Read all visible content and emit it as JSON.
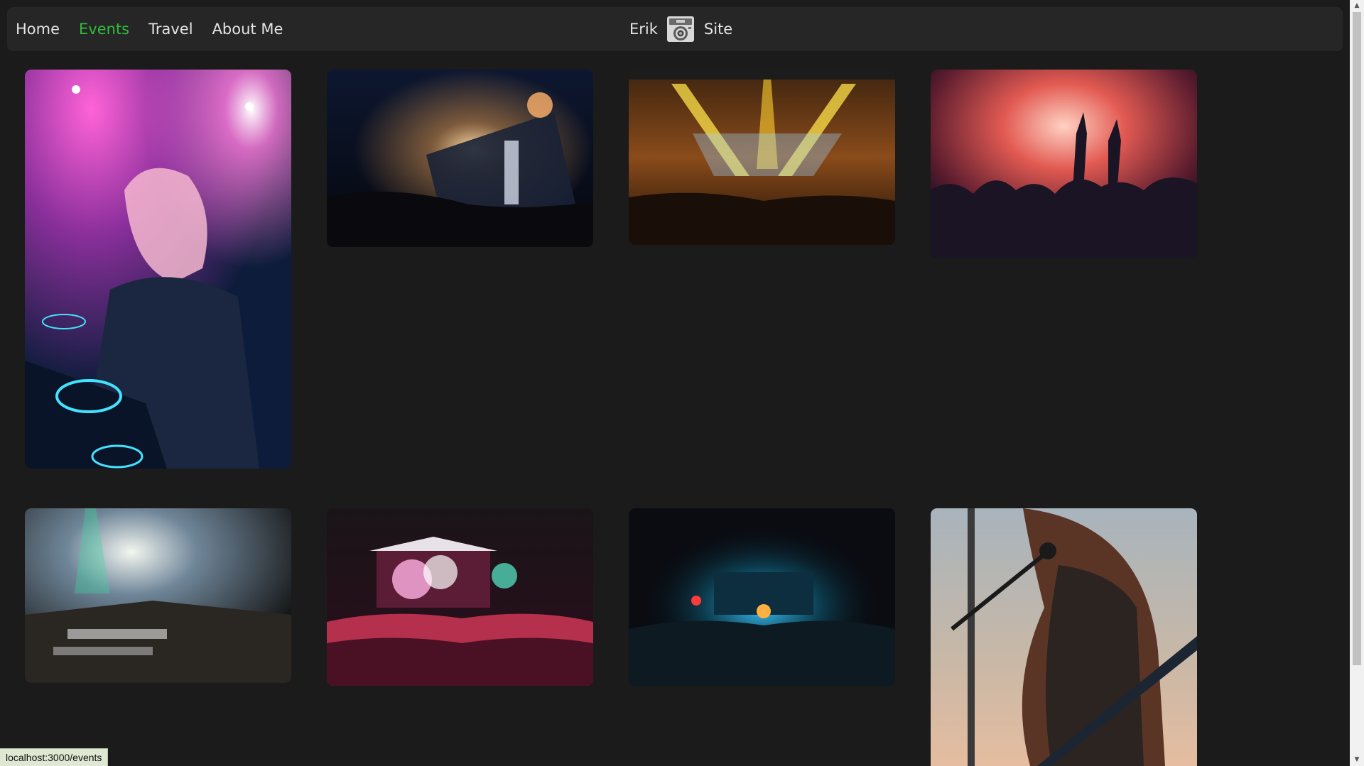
{
  "nav": {
    "links": [
      {
        "label": "Home"
      },
      {
        "label": "Events"
      },
      {
        "label": "Travel"
      },
      {
        "label": "About Me"
      }
    ],
    "active": "Events",
    "active_color": "#2fbe3c"
  },
  "brand": {
    "left_text": "Erik",
    "logo_icon": "camera-icon",
    "right_text": "Site"
  },
  "gallery": {
    "photos": [
      {
        "subject": "DJ at turntables under pink lights"
      },
      {
        "subject": "Festival stage with fireworks and crowd"
      },
      {
        "subject": "Concert hall with yellow and blue stage lights"
      },
      {
        "subject": "Crowd raising hands in red stage smoke"
      },
      {
        "subject": "Arena stage with confetti and spotlights"
      },
      {
        "subject": "Outdoor festival stage with colored smoke"
      },
      {
        "subject": "Night festival stage with blue lights"
      },
      {
        "subject": "Guitarist singing into microphone at sunset"
      }
    ]
  },
  "status_bar": {
    "url": "localhost:3000/events"
  },
  "colors": {
    "background": "#1b1b1b",
    "navbar": "#262626",
    "text": "#e4e4e4"
  }
}
